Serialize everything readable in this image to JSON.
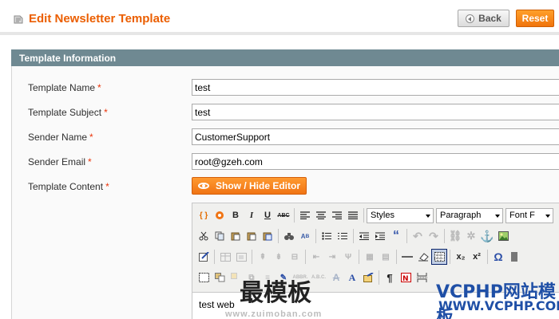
{
  "header": {
    "title": "Edit Newsletter Template",
    "back_label": "Back",
    "reset_label": "Reset",
    "accent_color": "#eb5e00"
  },
  "section": {
    "title": "Template Information"
  },
  "form": {
    "template_name": {
      "label": "Template Name",
      "required": "*",
      "value": "test"
    },
    "template_subject": {
      "label": "Template Subject",
      "required": "*",
      "value": "test"
    },
    "sender_name": {
      "label": "Sender Name",
      "required": "*",
      "value": "CustomerSupport"
    },
    "sender_email": {
      "label": "Sender Email",
      "required": "*",
      "value": "root@gzeh.com"
    },
    "template_content": {
      "label": "Template Content",
      "required": "*"
    },
    "show_hide_editor_label": "Show / Hide Editor"
  },
  "editor": {
    "styles_select": "Styles",
    "format_select": "Paragraph",
    "font_select": "Font F",
    "bold": "B",
    "italic": "I",
    "underline": "U",
    "strike": "ABC",
    "subscript": "x₂",
    "superscript": "x²",
    "omega": "Ω",
    "pilcrow": "¶",
    "abbr": "ABBR.",
    "acronym": "A.B.C.",
    "quote": "“",
    "content": "test web"
  },
  "watermarks": {
    "left": "最模板",
    "left_sub": "www.zuimoban.com",
    "right": "VCPHP网站模板",
    "right_sub": "WWW.VCPHP.COM"
  }
}
